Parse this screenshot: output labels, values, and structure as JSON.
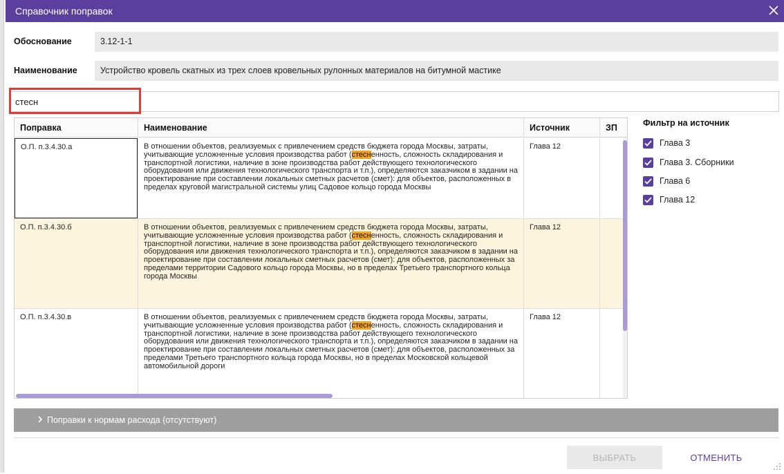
{
  "window": {
    "title": "Справочник поправок",
    "accent_color": "#5b3f9f",
    "close_icon": "close-icon"
  },
  "justification": {
    "label": "Обоснование",
    "value": "3.12-1-1"
  },
  "name_field": {
    "label": "Наименование",
    "value": "Устройство кровель скатных из трех слоев кровельных рулонных материалов на битумной мастике"
  },
  "search": {
    "value": "стесн",
    "placeholder": ""
  },
  "table": {
    "headers": {
      "code": "Поправка",
      "name": "Наименование",
      "source": "Источник",
      "zp": "ЗП"
    },
    "rows": [
      {
        "code": "О.П. п.3.4.30.а",
        "name_before": "В отношении объектов, реализуемых с привлечением средств бюджета города Москвы, затраты, учитывающие усложненные условия производства работ (",
        "name_match": "стесн",
        "name_after": "енность, сложность складирования и транспортной логистики, наличие в зоне производства работ действующего технологического оборудования или движения технологического транспорта и т.п.), определяются заказчиком в задании на проектирование при составлении локальных сметных расчетов (смет): для объектов, расположенных в пределах круговой магистральной системы улиц Садовое кольцо города Москвы",
        "source": "Глава 12",
        "zp": ""
      },
      {
        "code": "О.П. п.3.4.30.б",
        "name_before": "В отношении объектов, реализуемых с привлечением средств бюджета города Москвы, затраты, учитывающие усложненные условия производства работ (",
        "name_match": "стесн",
        "name_after": "енность, сложность складирования и транспортной логистики, наличие в зоне производства работ действующего технологического оборудования или движения технологического транспорта и т.п.), определяются заказчиком в задании на проектирование при составлении локальных сметных расчетов (смет): для объектов, расположенных за пределами территории Садового кольцо города Москвы, но в пределах Третьего транспортного кольца города Москвы",
        "source": "Глава 12",
        "zp": ""
      },
      {
        "code": "О.П. п.3.4.30.в",
        "name_before": "В отношении объектов, реализуемых с привлечением средств бюджета города Москвы, затраты, учитывающие усложненные условия производства работ (",
        "name_match": "стесн",
        "name_after": "енность, сложность складирования и транспортной логистики, наличие в зоне производства работ действующего технологического оборудования или движения технологического транспорта и т.п.), определяются заказчиком в задании на проектирование при составлении локальных сметных расчетов (смет): для объектов, расположенных за пределами Третьего транспортного кольца города Москвы, но в пределах Московской кольцевой автомобильной дороги",
        "source": "Глава 12",
        "zp": ""
      }
    ]
  },
  "filter": {
    "title": "Фильтр на источник",
    "items": [
      {
        "label": "Глава 3",
        "checked": true
      },
      {
        "label": "Глава 3. Сборники",
        "checked": true
      },
      {
        "label": "Глава 6",
        "checked": true
      },
      {
        "label": "Глава 12",
        "checked": true
      }
    ]
  },
  "accordion": {
    "label": "Поправки к нормам расхода (отсутствуют)",
    "icon": "chevron-right-icon"
  },
  "buttons": {
    "select": "ВЫБРАТЬ",
    "cancel": "ОТМЕНИТЬ"
  },
  "colors": {
    "highlight": "#f7a21b",
    "selected_row": "#fdf4dd",
    "scroll_thumb": "#a89bd8"
  }
}
